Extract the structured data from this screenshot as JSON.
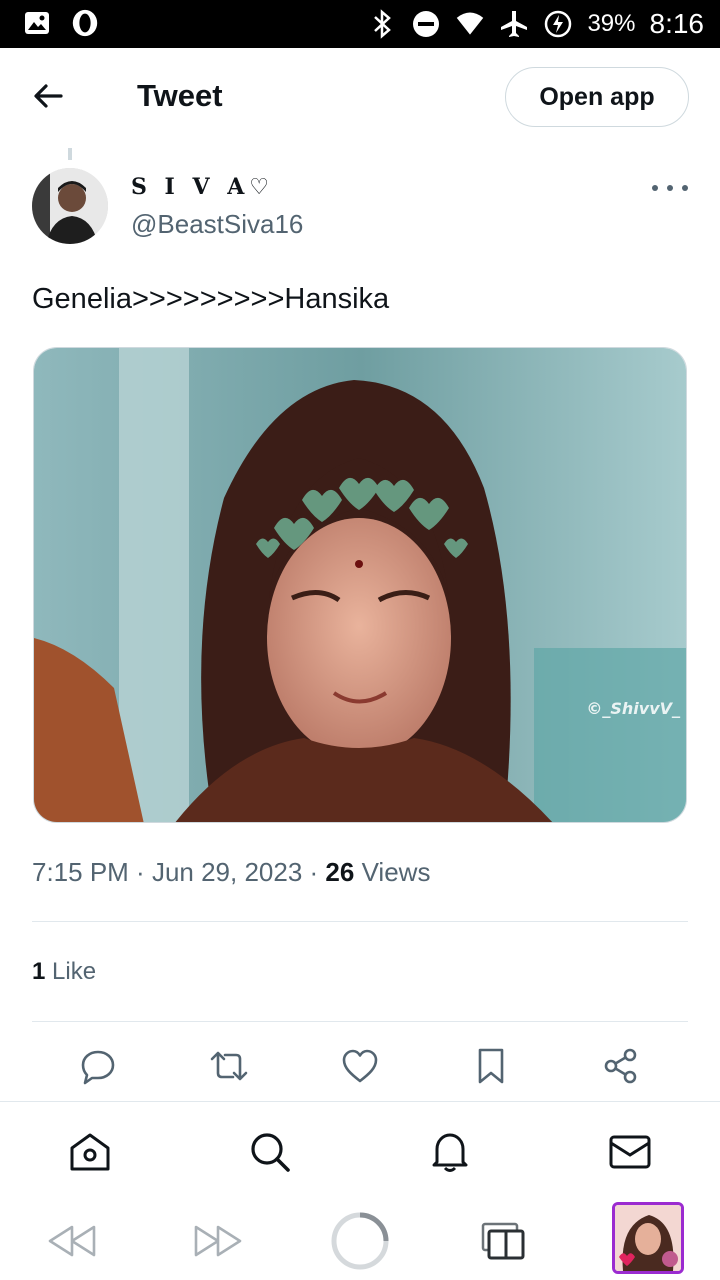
{
  "status_bar": {
    "battery": "39%",
    "time": "8:16",
    "icons": [
      "gallery-icon",
      "opera-icon",
      "bluetooth-icon",
      "dnd-icon",
      "wifi-icon",
      "airplane-icon",
      "battery-charging-icon"
    ]
  },
  "header": {
    "title": "Tweet",
    "open_app_label": "Open app",
    "back_icon": "back-arrow-icon"
  },
  "tweet": {
    "display_name": "S I V A♡",
    "handle": "@BeastSiva16",
    "text": "Genelia>>>>>>>>>Hansika",
    "watermark": "©_ShivvV_",
    "time": "7:15 PM",
    "date": "Jun 29, 2023",
    "views_count": "26",
    "views_label": "Views",
    "likes_count": "1",
    "likes_label": "Like"
  },
  "actions": [
    "reply-icon",
    "retweet-icon",
    "like-icon",
    "bookmark-icon",
    "share-icon"
  ],
  "bottom_nav": [
    "home-icon",
    "search-icon",
    "notifications-icon",
    "messages-icon"
  ],
  "browser_bar": [
    "browser-back-icon",
    "browser-forward-icon",
    "loading-icon",
    "tabs-icon",
    "tab-thumbnail"
  ],
  "colors": {
    "text_primary": "#0f1419",
    "text_secondary": "#536471",
    "border": "#cfd9de",
    "accent_tab": "#9b2bd0"
  }
}
